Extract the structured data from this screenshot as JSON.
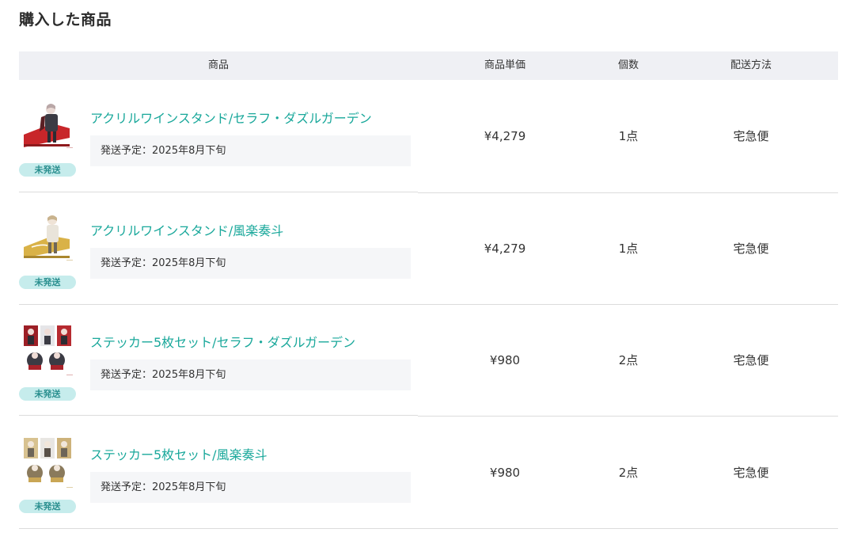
{
  "section": {
    "title": "購入した商品"
  },
  "table": {
    "headers": {
      "product": "商品",
      "unit_price": "商品単価",
      "quantity": "個数",
      "shipping_method": "配送方法"
    },
    "rows": [
      {
        "status": "未発送",
        "name": "アクリルワインスタンド/セラフ・ダズルガーデン",
        "ship_schedule": "発送予定：2025年8月下旬",
        "price": "¥4,279",
        "quantity": "1点",
        "shipping": "宅急便",
        "thumb_icon": "acrylic-stand-red-thumbnail"
      },
      {
        "status": "未発送",
        "name": "アクリルワインスタンド/風楽奏斗",
        "ship_schedule": "発送予定：2025年8月下旬",
        "price": "¥4,279",
        "quantity": "1点",
        "shipping": "宅急便",
        "thumb_icon": "acrylic-stand-gold-thumbnail"
      },
      {
        "status": "未発送",
        "name": "ステッカー5枚セット/セラフ・ダズルガーデン",
        "ship_schedule": "発送予定：2025年8月下旬",
        "price": "¥980",
        "quantity": "2点",
        "shipping": "宅急便",
        "thumb_icon": "sticker-set-red-thumbnail"
      },
      {
        "status": "未発送",
        "name": "ステッカー5枚セット/風楽奏斗",
        "ship_schedule": "発送予定：2025年8月下旬",
        "price": "¥980",
        "quantity": "2点",
        "shipping": "宅急便",
        "thumb_icon": "sticker-set-gold-thumbnail"
      }
    ]
  },
  "colors": {
    "link": "#1aa89b",
    "badge_bg": "#c6ecec",
    "badge_text": "#2a8f8f",
    "header_bg": "#eff0f4",
    "ship_box_bg": "#f5f6f8"
  }
}
